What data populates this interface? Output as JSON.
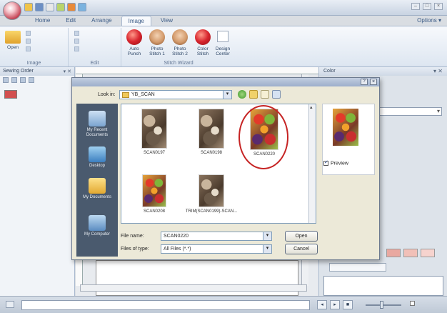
{
  "ribbon_tabs": [
    "Home",
    "Edit",
    "Arrange",
    "Image",
    "View"
  ],
  "active_tab": "Image",
  "options_label": "Options",
  "ribbon": {
    "open_label": "Open",
    "group_image": "Image",
    "group_edit": "Edit",
    "group_stitch": "Stitch Wizard",
    "buttons": [
      {
        "label": "Auto Punch",
        "icon": "apple-icon"
      },
      {
        "label": "Photo Stitch 1",
        "icon": "face-icon"
      },
      {
        "label": "Photo Stitch 2",
        "icon": "face-icon"
      },
      {
        "label": "Color Stitch",
        "icon": "apple-icon"
      },
      {
        "label": "Design Center",
        "icon": "design-center-icon"
      }
    ]
  },
  "sewing_order": {
    "title": "Sewing Order"
  },
  "color_panel": {
    "title": "Color"
  },
  "dialog": {
    "look_in_label": "Look in:",
    "look_in_value": "YB_SCAN",
    "places": [
      "My Recent Documents",
      "Desktop",
      "My Documents",
      "My Computer"
    ],
    "files": [
      {
        "name": "SCAN0197",
        "thumb": "sepia"
      },
      {
        "name": "SCAN0198",
        "thumb": "sepia"
      },
      {
        "name": "SCAN0220",
        "thumb": "fruit"
      },
      {
        "name": "SCAN0208",
        "thumb": "fruit"
      },
      {
        "name": "TRIM(SCAN0199)-SCAN...",
        "thumb": "sepia"
      }
    ],
    "preview_label": "Preview",
    "preview_checked": true,
    "file_name_label": "File name:",
    "file_name_value": "SCAN0220",
    "file_type_label": "Files of type:",
    "file_type_value": "All Files (*.*)",
    "open_button": "Open",
    "cancel_button": "Cancel",
    "help_glyph": "?",
    "close_glyph": "×"
  },
  "accent_colors": {
    "selection_circle": "#c62424",
    "ribbon": "#dde6f1",
    "places_bar": "#4a5a6e"
  }
}
